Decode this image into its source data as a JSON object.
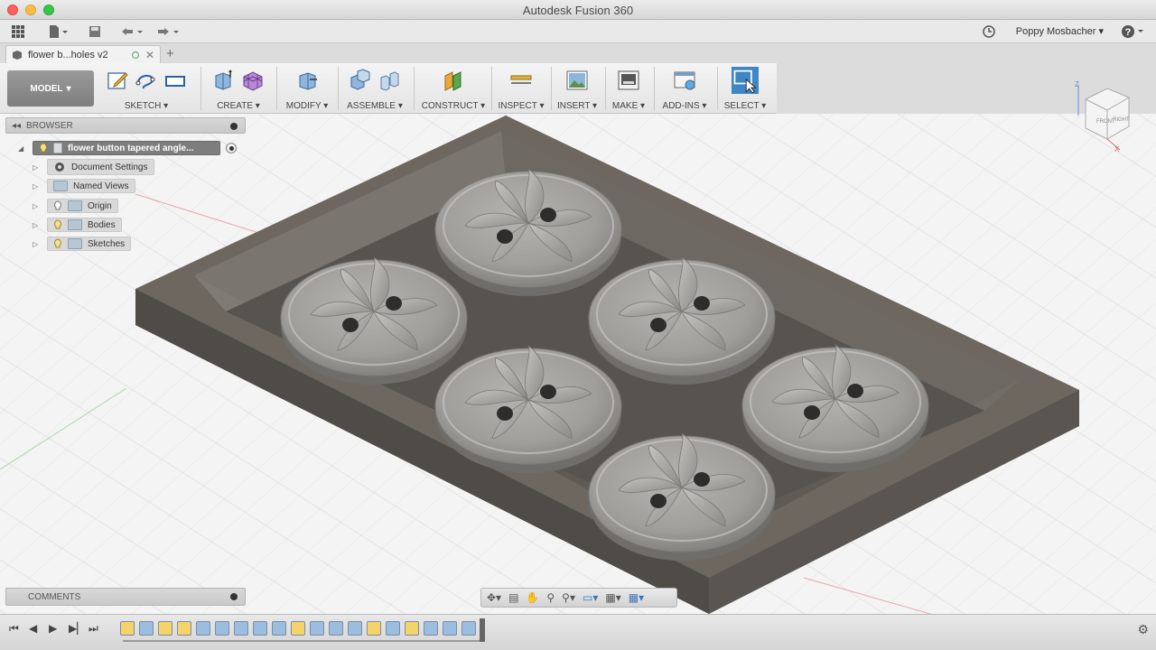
{
  "window": {
    "title": "Autodesk Fusion 360"
  },
  "topbar": {
    "user": "Poppy Mosbacher ▾"
  },
  "document_tab": {
    "label": "flower b...holes v2"
  },
  "ribbon": {
    "workspace": "MODEL",
    "groups": [
      "SKETCH ▾",
      "CREATE ▾",
      "MODIFY ▾",
      "ASSEMBLE ▾",
      "CONSTRUCT ▾",
      "INSPECT ▾",
      "INSERT ▾",
      "MAKE ▾",
      "ADD-INS ▾",
      "SELECT ▾"
    ]
  },
  "browser": {
    "title": "BROWSER",
    "root": "flower button tapered angle...",
    "items": [
      "Document Settings",
      "Named Views",
      "Origin",
      "Bodies",
      "Sketches"
    ]
  },
  "comments": {
    "title": "COMMENTS"
  },
  "viewcube": {
    "faces": [
      "FRONT",
      "RIGHT"
    ],
    "axes": [
      "Z",
      "X"
    ]
  },
  "colors": {
    "model": "#6b655e",
    "pocket": "#59544f",
    "button": "#a7a5a1",
    "select_group": "#3e86c4"
  }
}
